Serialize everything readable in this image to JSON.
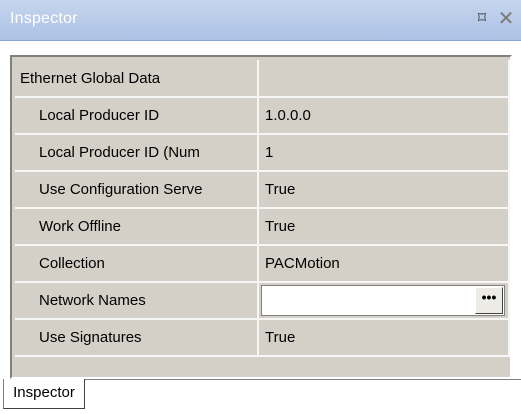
{
  "window": {
    "title": "Inspector",
    "pin_glyph": "⌑",
    "close_glyph": "✕"
  },
  "grid": {
    "category": {
      "name": "Ethernet Global Data",
      "value": ""
    },
    "properties": [
      {
        "name": "Local Producer ID",
        "value": "1.0.0.0"
      },
      {
        "name": "Local Producer ID (Num",
        "value": "1"
      },
      {
        "name": "Use Configuration Serve",
        "value": "True"
      },
      {
        "name": "Work Offline",
        "value": "True"
      },
      {
        "name": "Collection",
        "value": "PACMotion"
      },
      {
        "name": "Network Names",
        "value": ""
      },
      {
        "name": "Use Signatures",
        "value": "True"
      }
    ],
    "ellipsis_label": "•••"
  },
  "tabs": [
    {
      "label": "Inspector",
      "active": true
    }
  ],
  "colors": {
    "titlebar": "#b7cae9",
    "grid_background": "#d4d0c8",
    "grid_lines": "#f6f6f6"
  },
  "icons": {
    "pin": "pin-icon",
    "close": "close-icon",
    "ellipsis": "ellipsis-icon"
  }
}
